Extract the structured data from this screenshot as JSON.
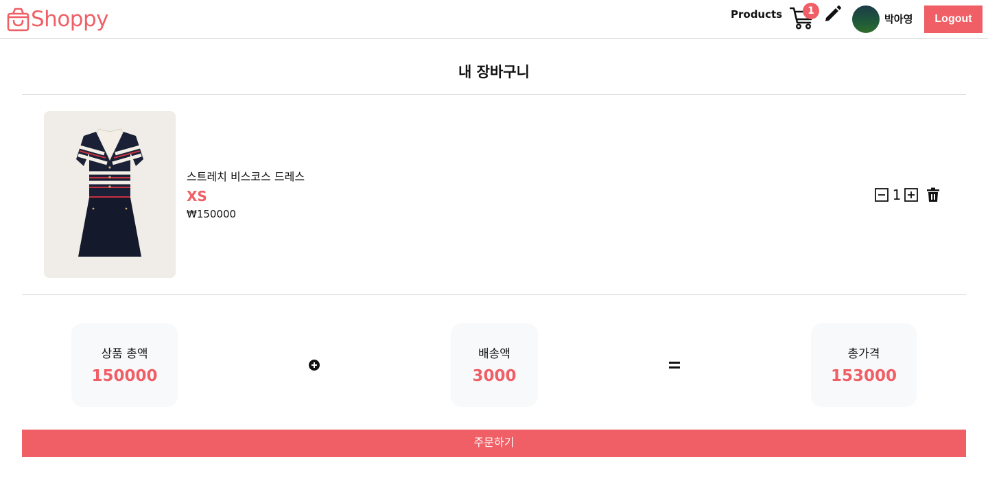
{
  "header": {
    "logo_text": "Shoppy",
    "nav_products": "Products",
    "cart_count": "1",
    "username": "박아영",
    "logout_label": "Logout"
  },
  "page": {
    "title": "내 장바구니"
  },
  "cart_items": [
    {
      "name": "스트레치 비스코스 드레스",
      "option": "XS",
      "price": "₩150000",
      "quantity": "1"
    }
  ],
  "summary": {
    "subtotal_label": "상품 총액",
    "subtotal_value": "150000",
    "shipping_label": "배송액",
    "shipping_value": "3000",
    "total_label": "총가격",
    "total_value": "153000"
  },
  "order_button_label": "주문하기",
  "colors": {
    "accent": "#ef5f65",
    "box_bg": "#f8f9fb",
    "divider": "#d9d9d9"
  },
  "icons": {
    "logo": "shopping-bag-icon",
    "cart": "cart-icon",
    "edit": "pencil-icon",
    "decrease": "minus-square-icon",
    "increase": "plus-square-icon",
    "remove": "trash-icon",
    "operator_plus": "plus-circle-icon",
    "operator_equals": "equals-icon"
  }
}
